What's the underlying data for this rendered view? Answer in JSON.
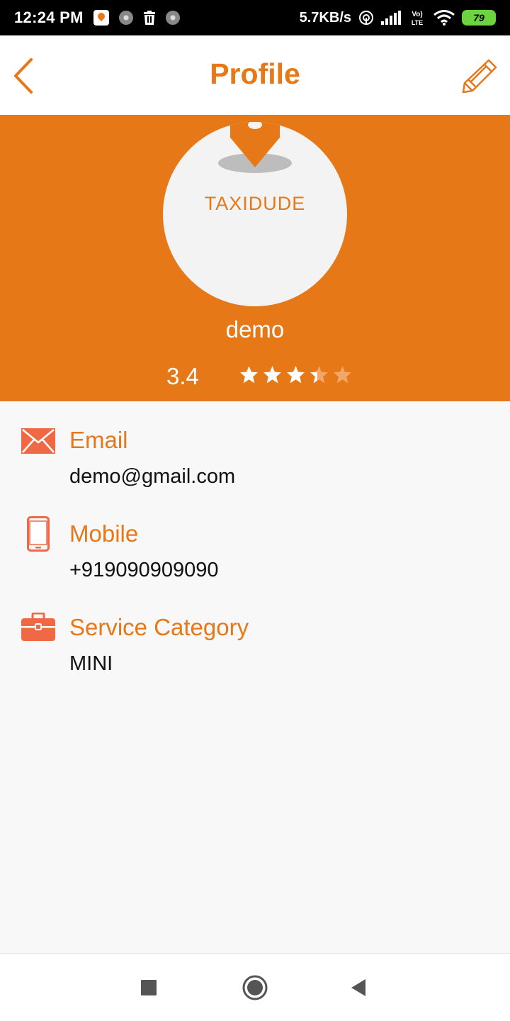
{
  "status_bar": {
    "time": "12:24 PM",
    "net_speed": "5.7KB/s",
    "network": "Vo LTE",
    "battery": "79",
    "icons": [
      "app-notification-icon",
      "circle-notification-icon",
      "trash-icon",
      "circle-notification-icon",
      "hotspot-icon",
      "signal-icon",
      "volte-icon",
      "wifi-icon",
      "battery-icon"
    ]
  },
  "app_bar": {
    "title": "Profile",
    "back_icon": "chevron-left-icon",
    "edit_icon": "pencil-icon"
  },
  "profile": {
    "logo_text": "TAXIDUDE",
    "name": "demo",
    "rating": "3.4",
    "rating_value": 3.4,
    "rating_max": 5
  },
  "details": [
    {
      "icon": "envelope-icon",
      "label": "Email",
      "value": "demo@gmail.com"
    },
    {
      "icon": "smartphone-icon",
      "label": "Mobile",
      "value": "+919090909090"
    },
    {
      "icon": "briefcase-icon",
      "label": "Service Category",
      "value": "MINI"
    }
  ],
  "nav_bar": {
    "icons": [
      "recents-square-icon",
      "home-circle-icon",
      "back-triangle-icon"
    ]
  },
  "colors": {
    "accent": "#e67817",
    "icon_accent": "#ef6a44",
    "status_bar": "#000000",
    "background": "#f8f8f8",
    "battery": "#6dd33e"
  }
}
